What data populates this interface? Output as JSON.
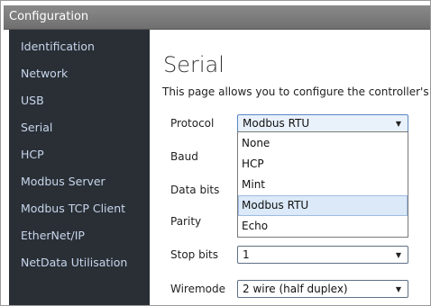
{
  "window": {
    "title": "Configuration"
  },
  "sidebar": {
    "items": [
      {
        "label": "Identification"
      },
      {
        "label": "Network"
      },
      {
        "label": "USB"
      },
      {
        "label": "Serial"
      },
      {
        "label": "HCP"
      },
      {
        "label": "Modbus Server"
      },
      {
        "label": "Modbus TCP Client"
      },
      {
        "label": "EtherNet/IP"
      },
      {
        "label": "NetData Utilisation"
      }
    ]
  },
  "page": {
    "title": "Serial",
    "description": "This page allows you to configure the controller's"
  },
  "form": {
    "protocol": {
      "label": "Protocol",
      "value": "Modbus RTU",
      "options": [
        "None",
        "HCP",
        "Mint",
        "Modbus RTU",
        "Echo"
      ],
      "highlighted": "Modbus RTU"
    },
    "baud": {
      "label": "Baud"
    },
    "data_bits": {
      "label": "Data bits"
    },
    "parity": {
      "label": "Parity"
    },
    "stop_bits": {
      "label": "Stop bits",
      "value": "1"
    },
    "wiremode": {
      "label": "Wiremode",
      "value": "2 wire (half duplex)"
    }
  },
  "icons": {
    "dropdown_arrow": "chevron-down-icon"
  }
}
